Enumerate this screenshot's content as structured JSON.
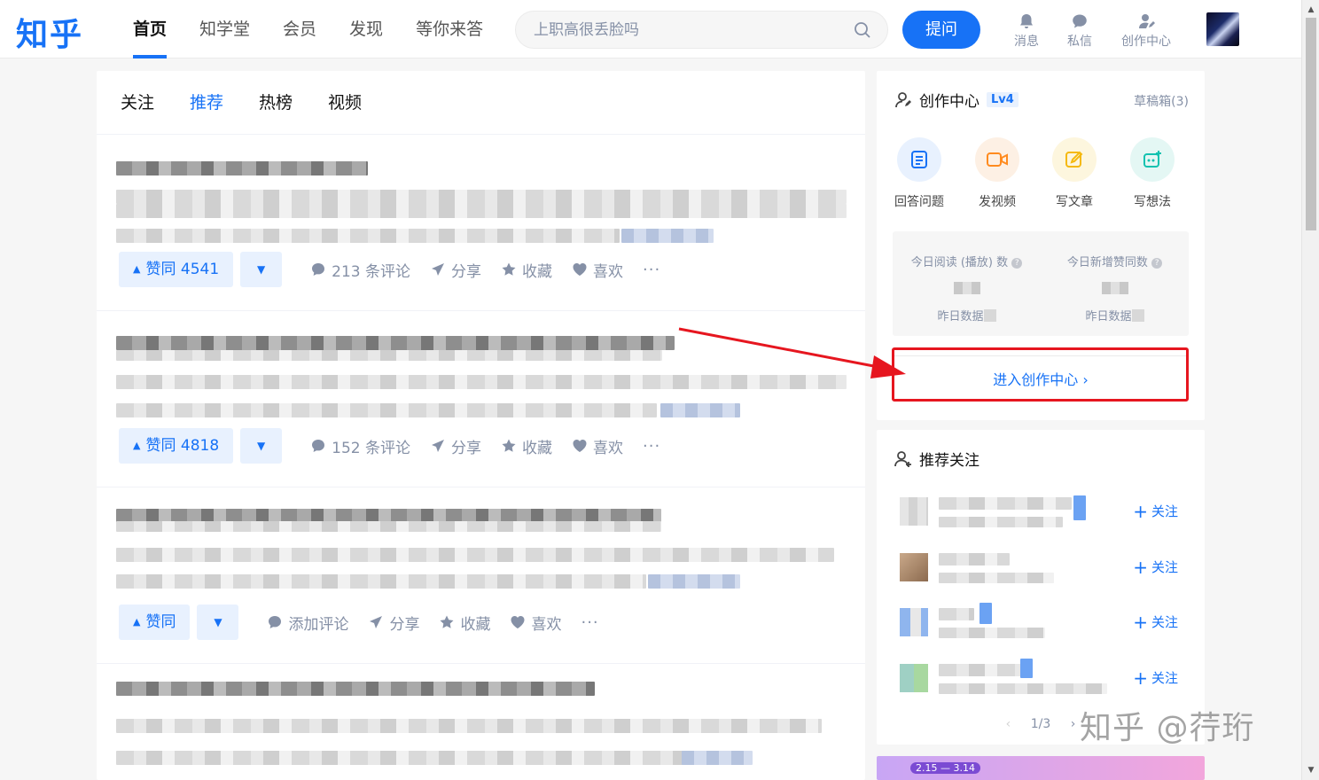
{
  "header": {
    "logo": "知乎",
    "nav": [
      "首页",
      "知学堂",
      "会员",
      "发现",
      "等你来答"
    ],
    "search_placeholder": "上职高很丢脸吗",
    "ask_label": "提问",
    "icons": [
      {
        "label": "消息",
        "icon": "bell-icon"
      },
      {
        "label": "私信",
        "icon": "chat-icon"
      },
      {
        "label": "创作中心",
        "icon": "creator-icon"
      }
    ]
  },
  "feed": {
    "tabs": [
      "关注",
      "推荐",
      "热榜",
      "视频"
    ],
    "active_tab": "推荐",
    "items": [
      {
        "upvote": "赞同 4541",
        "comments": "213 条评论",
        "share": "分享",
        "favorite": "收藏",
        "like": "喜欢",
        "more": "···"
      },
      {
        "upvote": "赞同 4818",
        "comments": "152 条评论",
        "share": "分享",
        "favorite": "收藏",
        "like": "喜欢",
        "more": "···"
      },
      {
        "upvote": "赞同",
        "comments": "添加评论",
        "share": "分享",
        "favorite": "收藏",
        "like": "喜欢",
        "more": "···"
      }
    ]
  },
  "creator": {
    "title": "创作中心",
    "level": "Lv4",
    "drafts": "草稿箱(3)",
    "tools": [
      {
        "label": "回答问题",
        "icon": "answer-icon",
        "color": "#e8f1fe"
      },
      {
        "label": "发视频",
        "icon": "video-icon",
        "color": "#fdf0e4"
      },
      {
        "label": "写文章",
        "icon": "write-icon",
        "color": "#fdf6de"
      },
      {
        "label": "写想法",
        "icon": "idea-icon",
        "color": "#e4f7f4"
      }
    ],
    "stats": [
      {
        "label": "今日阅读 (播放) 数",
        "yesterday": "昨日数据"
      },
      {
        "label": "今日新增赞同数",
        "yesterday": "昨日数据"
      }
    ],
    "enter_label": "进入创作中心 ›"
  },
  "recommend": {
    "title": "推荐关注",
    "follow_label": "关注",
    "pager": "1/3"
  },
  "promo": {
    "dates": "2.15 — 3.14"
  },
  "watermark": "知乎 @荇珩",
  "colors": {
    "brand": "#1772f6",
    "highlight": "#e6161f"
  }
}
